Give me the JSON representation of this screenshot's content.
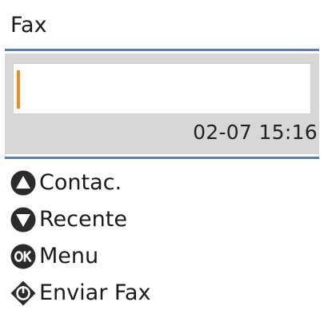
{
  "header": {
    "title": "Fax"
  },
  "entry": {
    "fax_number_value": "",
    "datetime": "02-07 15:16"
  },
  "menu": {
    "items": [
      {
        "label": "Contac.",
        "icon": "up-triangle-button-icon"
      },
      {
        "label": "Recente",
        "icon": "down-triangle-button-icon"
      },
      {
        "label": "Menu",
        "icon": "ok-button-icon"
      },
      {
        "label": "Enviar Fax",
        "icon": "start-diamond-button-icon"
      }
    ]
  },
  "colors": {
    "divider": "#5a7fb0",
    "panel": "#d7d7d7",
    "cursor": "#f08a1c",
    "icon": "#2b2b2b"
  }
}
